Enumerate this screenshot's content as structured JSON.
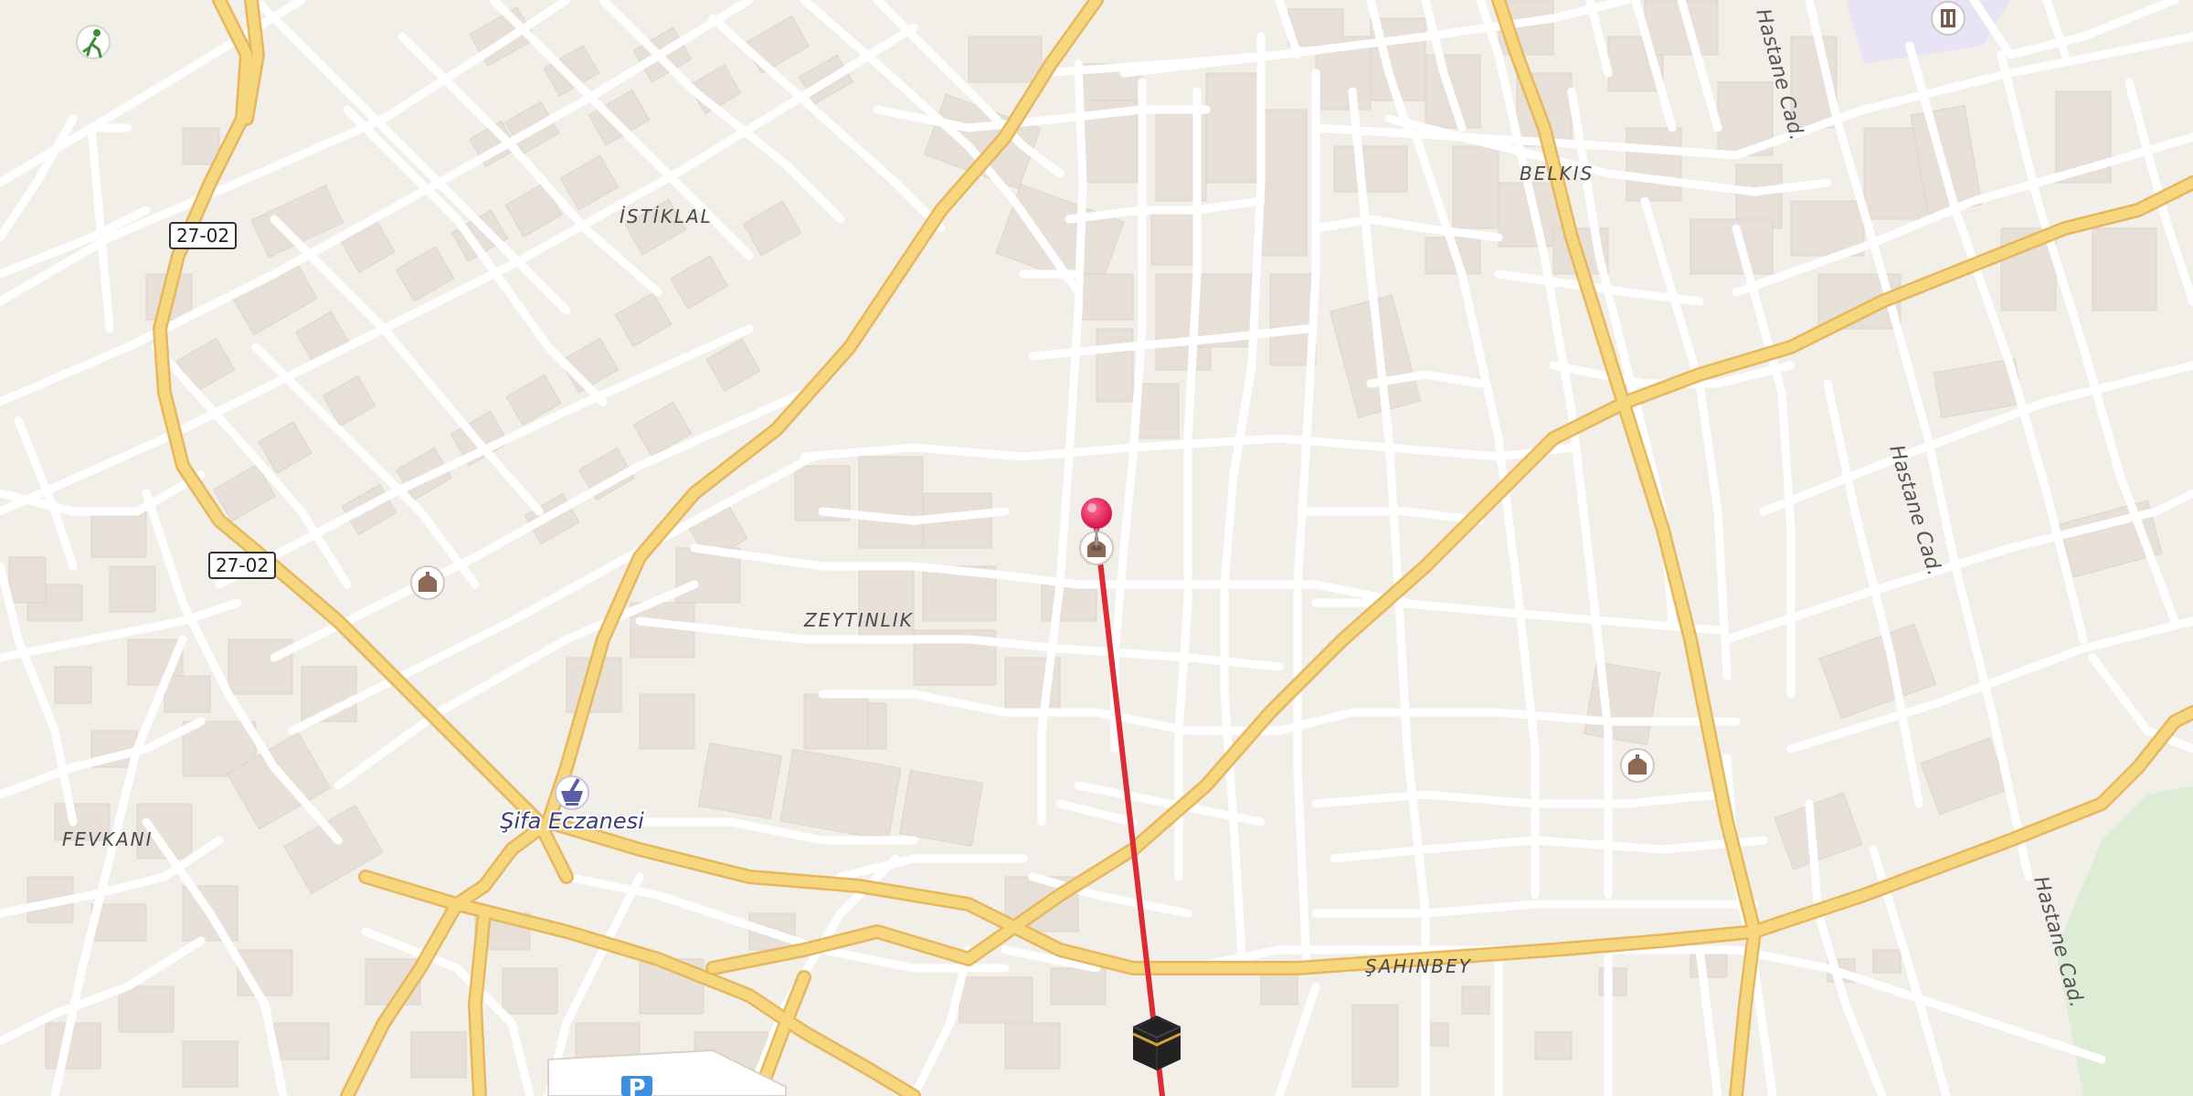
{
  "map": {
    "neighborhoods": {
      "istiklal": "İSTİKLAL",
      "belkis": "BELKIS",
      "zeytinlik": "ZEYTINLIK",
      "fevkani": "FEVKANI",
      "sahinbey": "ŞAHINBEY"
    },
    "streets": {
      "hastane_1": "Hastane Cad.",
      "hastane_2": "Hastane Cad.",
      "hastane_3": "Hastane Cad."
    },
    "route_shields": {
      "shield_1": "27-02",
      "shield_2": "27-02"
    },
    "pois": {
      "pharmacy": "Şifa Eczanesi"
    },
    "parking_symbol": "P",
    "icons": [
      "mosque-icon",
      "pharmacy-icon",
      "kaaba-icon",
      "map-pin-icon",
      "sports-icon",
      "hospital-icon",
      "parking-icon"
    ],
    "colors": {
      "background": "#f2efe9",
      "major_road": "#f7d77d",
      "minor_road": "#ffffff",
      "building": "#e7e0d8",
      "route_line": "#dd2a35",
      "pin": "#e91e63",
      "park": "#dcecd5",
      "hospital_area": "#e8e4f6"
    }
  }
}
